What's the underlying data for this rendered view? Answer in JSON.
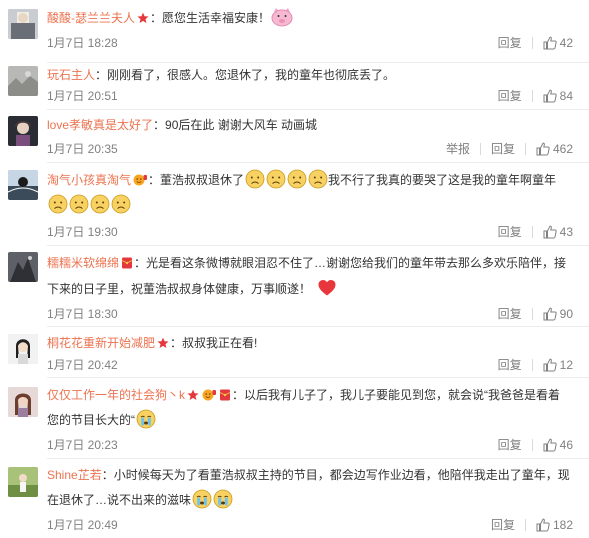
{
  "labels": {
    "reply": "回复",
    "report": "举报"
  },
  "colors": {
    "username": "#eb7350",
    "meta": "#808080",
    "text": "#333333"
  },
  "comments": [
    {
      "user": "酸酸-瑟兰兰夫人",
      "text": "愿您生活幸福安康！",
      "time": "1月7日 18:28",
      "likes": "42",
      "badges": [
        "star-badge"
      ],
      "emojis": [
        "pink-pig-emoji"
      ]
    },
    {
      "user": "玩石主人",
      "text": "刚刚看了，很感人。您退休了，我的童年也彻底丢了。",
      "time": "1月7日 20:51",
      "likes": "84"
    },
    {
      "user": "love孝敏真是太好了",
      "text": "90后在此 谢谢大风车 动画城",
      "time": "1月7日 20:35",
      "likes": "462"
    },
    {
      "user": "淘气小孩真淘气",
      "text1": "董浩叔叔退休了",
      "text2": "我不行了我真的要哭了这是我的童年啊童年",
      "time": "1月7日 19:30",
      "likes": "43",
      "badges": [
        "smiley-badge"
      ]
    },
    {
      "user": "糯糯米软绵绵",
      "line1": "光是看这条微博就眼泪忍不住了…谢谢您给我们的童年带去那么多欢乐陪伴，接",
      "line2": "下来的日子里，祝董浩叔叔身体健康，万事顺遂！",
      "time": "1月7日 18:30",
      "likes": "90",
      "badges": [
        "red-envelope-badge"
      ]
    },
    {
      "user": "桐花花重新开始减肥",
      "text": "叔叔我正在看!",
      "time": "1月7日 20:42",
      "likes": "12",
      "badges": [
        "star-badge"
      ]
    },
    {
      "user": "仅仅工作一年的社会狗丶k",
      "line1": "以后我有儿子了，我儿子要能见到您，就会说“我爸爸是看着",
      "line2": "您的节目长大的“",
      "time": "1月7日 20:23",
      "likes": "46",
      "badges": [
        "star-badge",
        "smiley-badge",
        "red-envelope-badge"
      ]
    },
    {
      "user": "Shine芷若",
      "line1": "小时候每天为了看董浩叔叔主持的节目，都会边写作业边看，他陪伴我走出了童年，现",
      "line2": "在退休了…说不出来的滋味",
      "time": "1月7日 20:49",
      "likes": "182"
    }
  ]
}
